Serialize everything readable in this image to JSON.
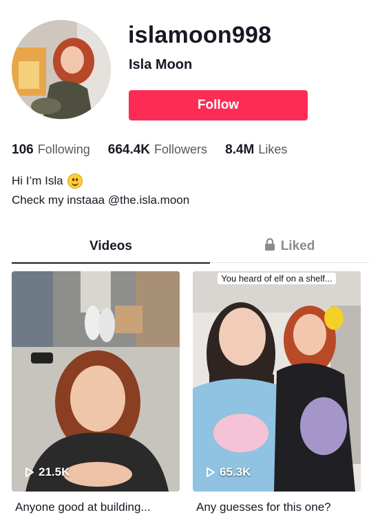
{
  "profile": {
    "username": "islamoon998",
    "display_name": "Isla Moon",
    "follow_label": "Follow"
  },
  "stats": [
    {
      "value": "106",
      "label": "Following"
    },
    {
      "value": "664.4K",
      "label": "Followers"
    },
    {
      "value": "8.4M",
      "label": "Likes"
    }
  ],
  "bio": {
    "line1": "Hi I’m Isla",
    "line2": "Check my instaaa @the.isla.moon"
  },
  "tabs": {
    "videos": "Videos",
    "liked": "Liked"
  },
  "videos": [
    {
      "views": "21.5K",
      "caption": "Anyone good at building...",
      "overlay_text": ""
    },
    {
      "views": "65.3K",
      "caption": "Any guesses for this one?",
      "overlay_text": "You heard of elf on a shelf..."
    }
  ],
  "colors": {
    "follow_button": "#fe2c55",
    "text_primary": "#161823",
    "text_secondary": "#57585f"
  }
}
